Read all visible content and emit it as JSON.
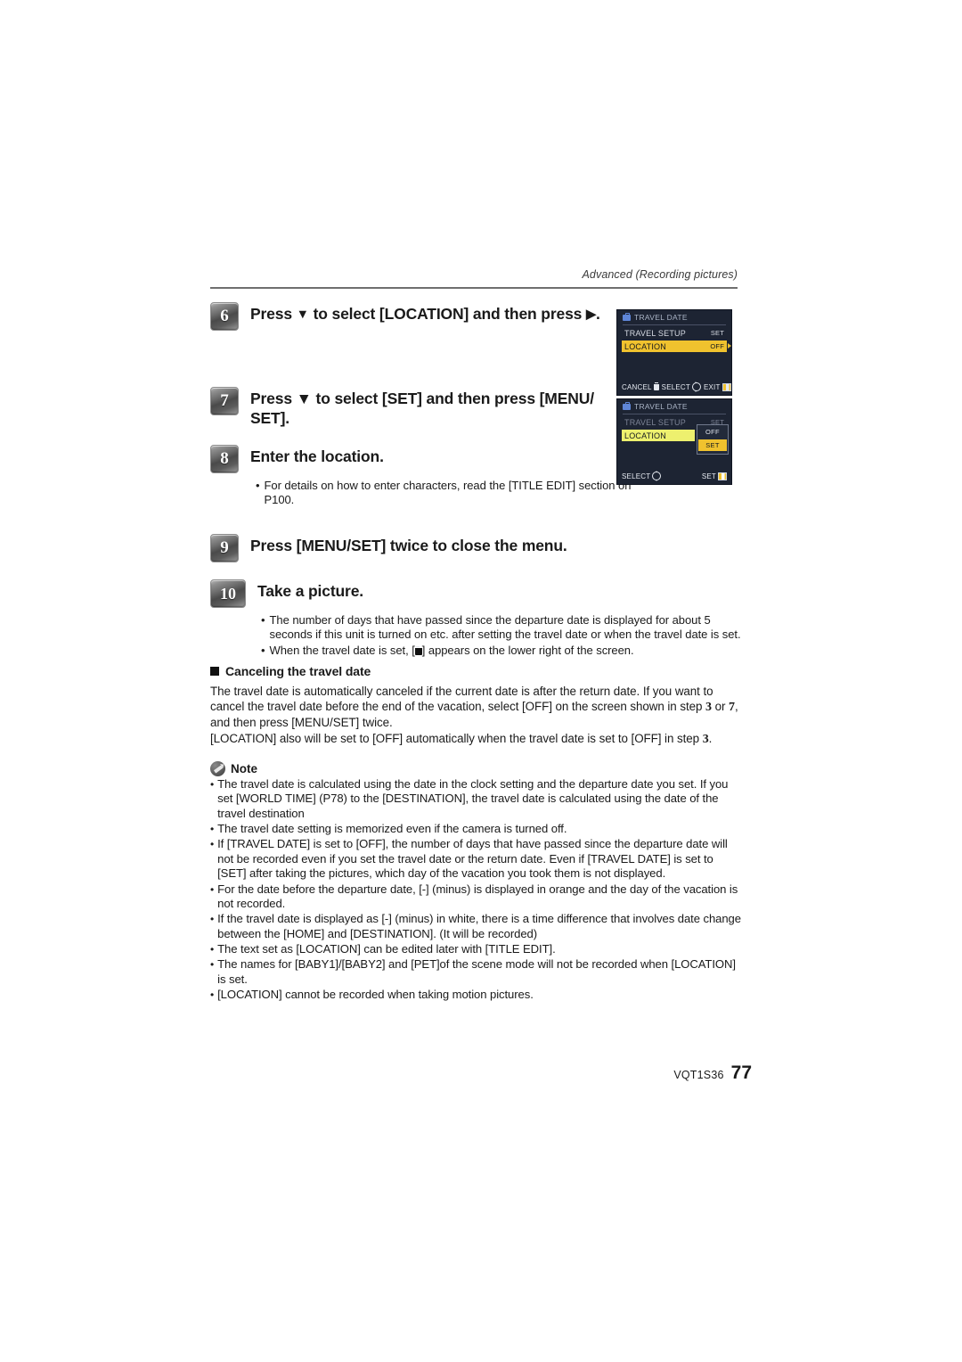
{
  "header": {
    "running_head": "Advanced (Recording pictures)"
  },
  "steps": [
    {
      "number": "6",
      "title_pre": "Press ",
      "title_arrow": "▼",
      "title_mid": " to select [LOCATION] and then press ",
      "title_arrow2": "▶",
      "title_post": "."
    },
    {
      "number": "7",
      "title": "Press ▼ to select [SET] and then press [MENU/ SET]."
    },
    {
      "number": "8",
      "title": "Enter the location.",
      "bullets": [
        "For details on how to enter characters, read the [TITLE EDIT] section on P100."
      ]
    },
    {
      "number": "9",
      "title": "Press [MENU/SET] twice to close the menu."
    },
    {
      "number": "10",
      "title": "Take a picture.",
      "bullets": [
        "The number of days that have passed since the departure date is displayed for about 5 seconds if this unit is turned on etc. after setting the travel date or when the travel date is set.",
        "When the travel date is set, [\u0001] appears on the lower right of the screen."
      ]
    }
  ],
  "canceling": {
    "heading": "Canceling the travel date",
    "paragraph1_a": "The travel date is automatically canceled if the current date is after the return date. If you want to cancel the travel date before the end of the vacation, select [OFF] on the screen shown in step ",
    "paragraph1_step_a": "3",
    "paragraph1_b": " or ",
    "paragraph1_step_b": "7",
    "paragraph1_c": ", and then press [MENU/SET] twice.",
    "paragraph2_a": "[LOCATION] also will be set to [OFF] automatically when the travel date is set to [OFF] in step ",
    "paragraph2_step": "3",
    "paragraph2_b": "."
  },
  "note": {
    "label": "Note",
    "items": [
      "The travel date is calculated using the date in the clock setting and the departure date you set. If you set [WORLD TIME] (P78) to the [DESTINATION], the travel date is calculated using the date of the travel destination",
      "The travel date setting is memorized even if the camera is turned off.",
      "If [TRAVEL DATE] is set to [OFF], the number of days that have passed since the departure date will not be recorded even if you set the travel date or the return date. Even if [TRAVEL DATE] is set to [SET] after taking the pictures, which day of the vacation you took them is not displayed.",
      "For the date before the departure date, [-] (minus) is displayed in orange and the day of the vacation is not recorded.",
      "If the travel date is displayed as [-] (minus) in white, there is a time difference that involves date change between the [HOME] and [DESTINATION]. (It will be recorded)",
      "The text set as [LOCATION] can be edited later with [TITLE EDIT].",
      "The names for [BABY1]/[BABY2] and [PET]of the scene mode will not be recorded when [LOCATION] is set.",
      "[LOCATION] cannot be recorded when taking motion pictures."
    ]
  },
  "screenshots": [
    {
      "title": "TRAVEL DATE",
      "rows": [
        {
          "label": "TRAVEL SETUP",
          "value": "SET",
          "highlighted": false
        },
        {
          "label": "LOCATION",
          "value": "OFF",
          "highlighted": true
        }
      ],
      "footer": [
        "CANCEL",
        "SELECT",
        "EXIT"
      ]
    },
    {
      "title": "TRAVEL DATE",
      "rows": [
        {
          "label": "TRAVEL SETUP",
          "value": "SET",
          "highlighted": false
        },
        {
          "label": "LOCATION",
          "value": "",
          "highlighted": true
        }
      ],
      "dropdown": {
        "options": [
          "OFF",
          "SET"
        ],
        "selected": "SET"
      },
      "footer": [
        "SELECT",
        "SET"
      ]
    }
  ],
  "footer": {
    "code": "VQT1S36",
    "page_number": "77"
  },
  "colors": {
    "highlight": "#f0c22e",
    "highlight_dim": "#edf06e",
    "screen_bg": "#1d2433",
    "title_blue": "#5f86d8"
  }
}
